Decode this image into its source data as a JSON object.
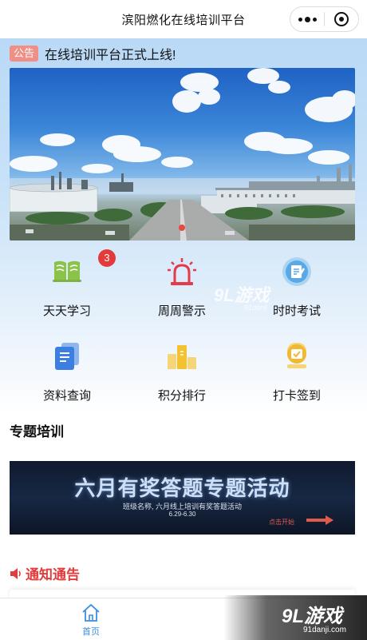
{
  "window": {
    "title": "滨阳燃化在线培训平台"
  },
  "notice": {
    "tag": "公告",
    "text": "在线培训平台正式上线!"
  },
  "grid": [
    {
      "label": "天天学习",
      "icon": "book-icon",
      "badge": "3",
      "color": "#8bc34a"
    },
    {
      "label": "周周警示",
      "icon": "alarm-light-icon",
      "color": "#e5394c"
    },
    {
      "label": "时时考试",
      "icon": "exam-icon",
      "color": "#5aa9e6"
    },
    {
      "label": "资料查询",
      "icon": "documents-icon",
      "color": "#3d7fe0"
    },
    {
      "label": "积分排行",
      "icon": "ranking-icon",
      "color": "#f2c230"
    },
    {
      "label": "打卡签到",
      "icon": "check-in-icon",
      "color": "#f2b830"
    }
  ],
  "special_training": {
    "title": "专题培训",
    "promo": {
      "headline": "六月有奖答题专题活动",
      "subtitle": "班级名称, 六月线上培训有奖答题活动",
      "date": "6.29-6.30",
      "cta": "点击开始"
    }
  },
  "announcements": {
    "title": "通知通告"
  },
  "tabbar": {
    "home_label": "首页",
    "home_color": "#3b8fe0"
  },
  "watermark": {
    "logo_text": "9L游戏",
    "small_text": "91danji",
    "url": "91danji.com"
  }
}
